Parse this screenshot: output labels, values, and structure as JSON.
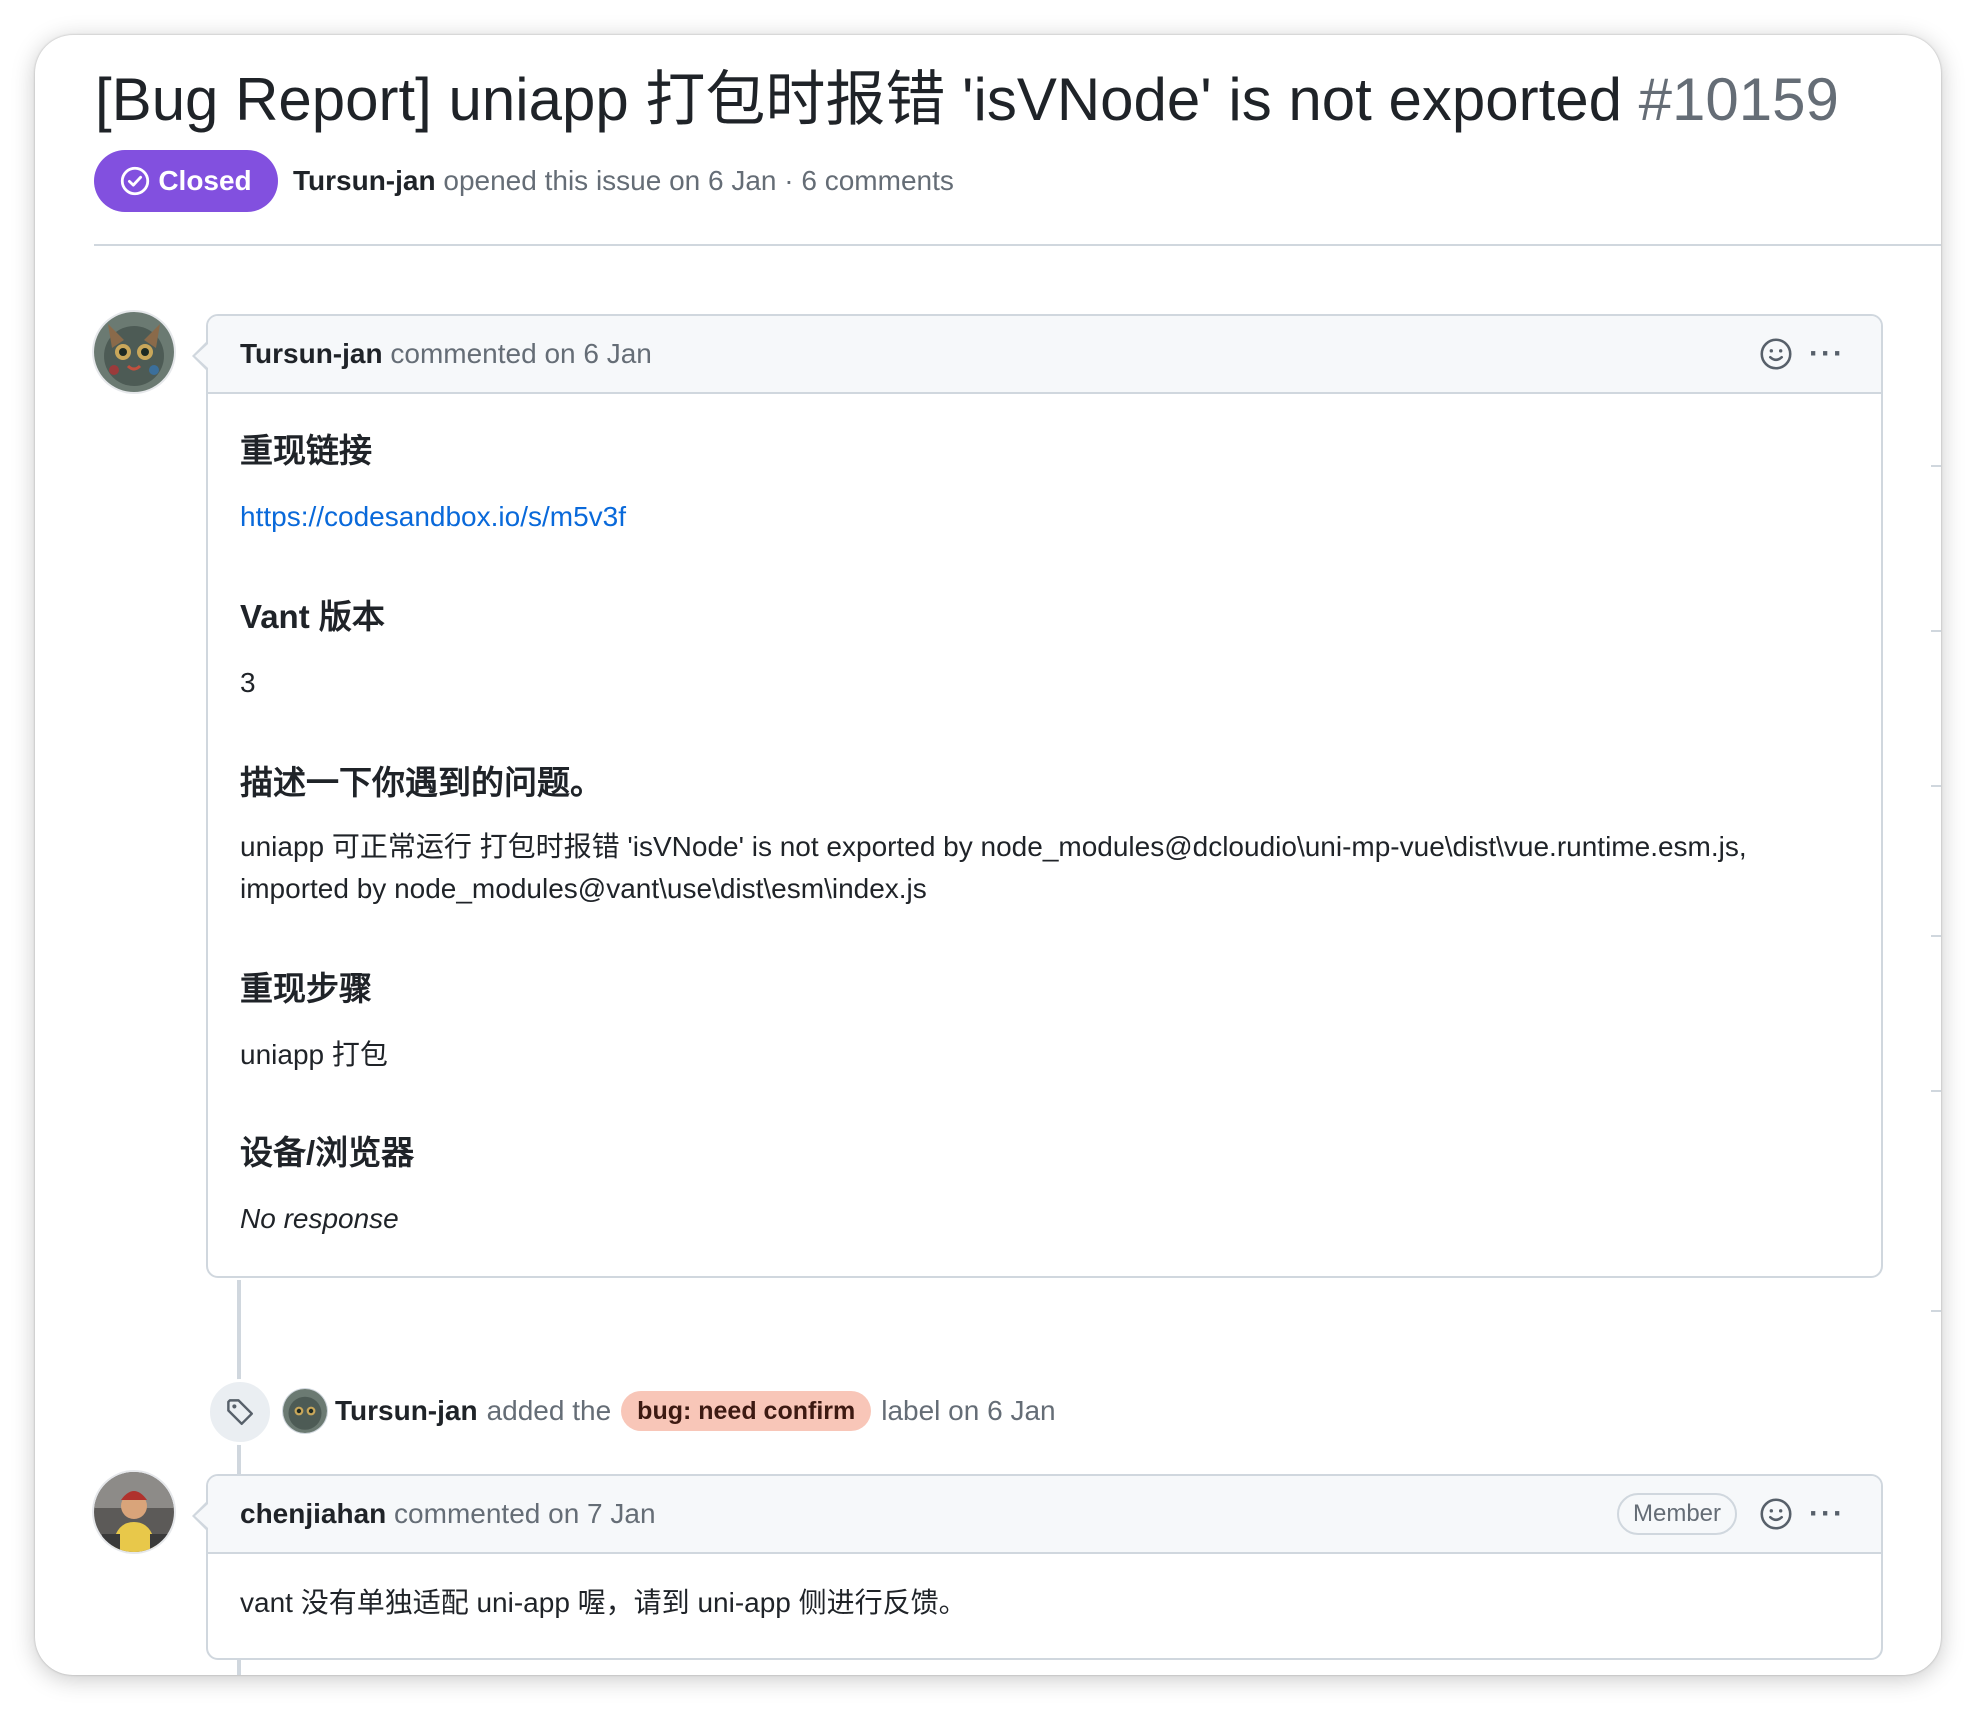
{
  "issue": {
    "title": "[Bug Report] uniapp 打包时报错 'isVNode' is not exported",
    "number": "#10159",
    "status": "Closed",
    "author": "Tursun-jan",
    "meta_suffix": "opened this issue on 6 Jan · 6 comments"
  },
  "comments": [
    {
      "author": "Tursun-jan",
      "action": "commented on 6 Jan",
      "sections": [
        {
          "heading": "重现链接",
          "text": "https://codesandbox.io/s/m5v3f",
          "is_link": true
        },
        {
          "heading": "Vant 版本",
          "text": "3"
        },
        {
          "heading": "描述一下你遇到的问题。",
          "text": "uniapp 可正常运行 打包时报错 'isVNode' is not exported by node_modules@dcloudio\\uni-mp-vue\\dist\\vue.runtime.esm.js, imported by node_modules@vant\\use\\dist\\esm\\index.js"
        },
        {
          "heading": "重现步骤",
          "text": "uniapp 打包"
        },
        {
          "heading": "设备/浏览器",
          "text": "No response",
          "italic": true
        }
      ]
    },
    {
      "author": "chenjiahan",
      "action": "commented on 7 Jan",
      "badge": "Member",
      "body": "vant 没有单独适配 uni-app 喔，请到 uni-app 侧进行反馈。"
    }
  ],
  "event": {
    "actor": "Tursun-jan",
    "text_before": "added the",
    "label": "bug: need confirm",
    "text_after": "label on 6 Jan",
    "label_color": "#f8c6b8"
  },
  "colors": {
    "closed_purple": "#8250df",
    "link_blue": "#0969da",
    "border": "#d0d7de",
    "header_bg": "#f6f8fa"
  },
  "icons": {
    "status": "check-circle-icon",
    "reaction": "smiley-icon",
    "menu": "kebab-horizontal-icon",
    "event": "tag-icon"
  }
}
